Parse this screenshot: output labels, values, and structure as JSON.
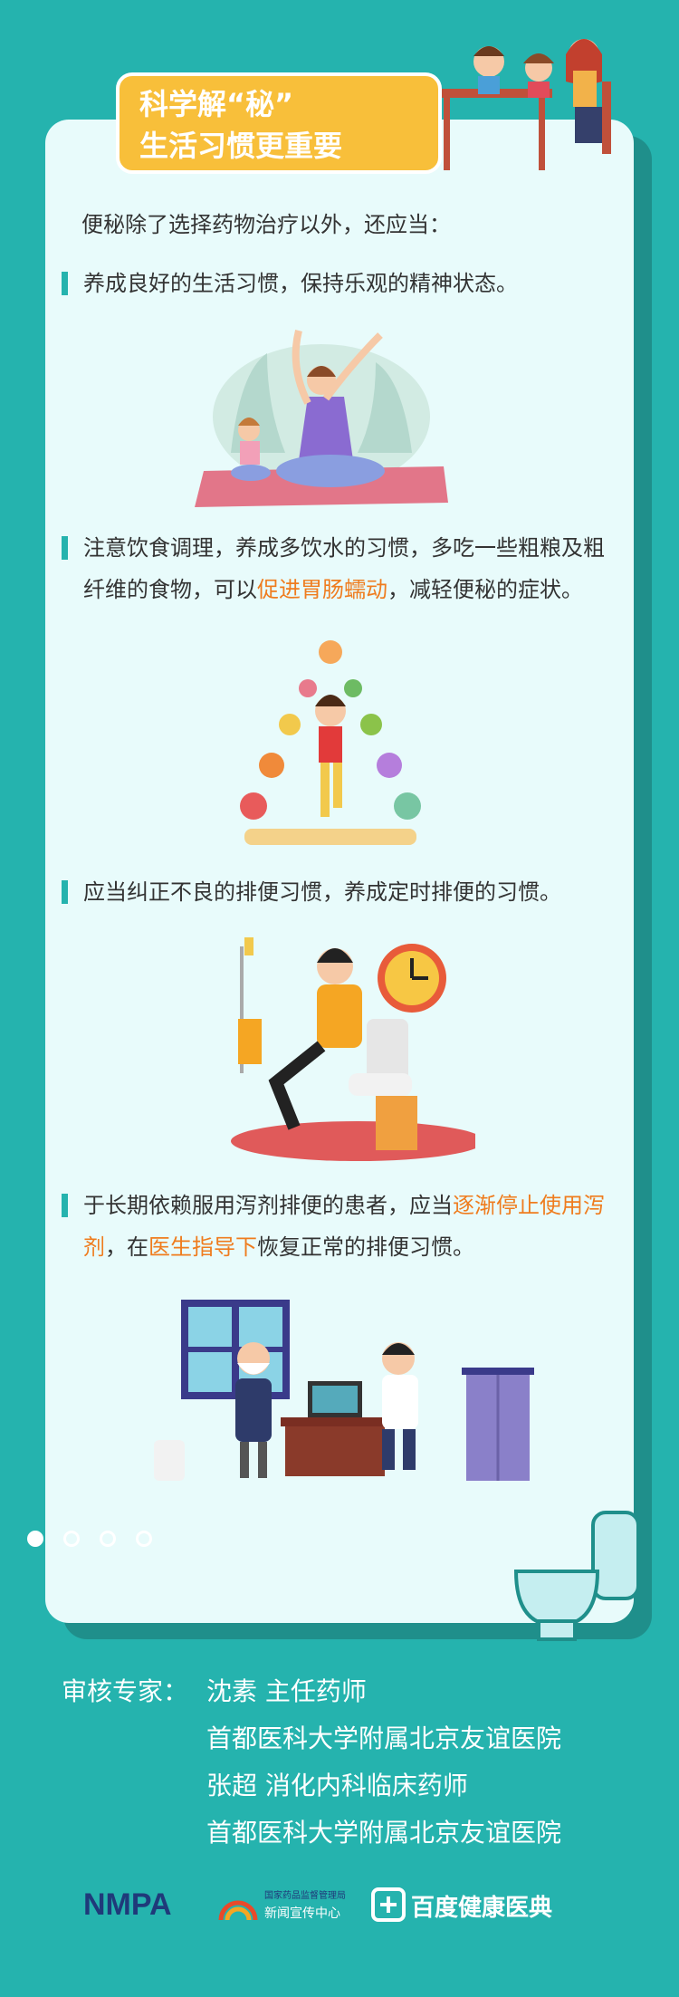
{
  "title": {
    "line1": "科学解“秘”",
    "line2": "生活习惯更重要"
  },
  "intro": "便秘除了选择药物治疗以外，还应当：",
  "points": [
    {
      "pre": "养成良好的生活习惯，保持乐观的精神状态。"
    },
    {
      "pre": "注意饮食调理，养成多饮水的习惯，多吃一些粗粮及粗纤维的食物，可以",
      "hl": "促进胃肠蠕动",
      "post": "，减轻便秘的症状。"
    },
    {
      "pre": "应当纠正不良的排便习惯，养成定时排便的习惯。"
    },
    {
      "pre": "于长期依赖服用泻剂排便的患者，应当",
      "hl": "逐渐停止使用泻剂",
      "mid": "，在",
      "hl2": "医生指导下",
      "post": "恢复正常的排便习惯。"
    }
  ],
  "footer": {
    "reviewer_label": "审核专家：",
    "expert1": "沈素  主任药师",
    "hospital1": "首都医科大学附属北京友谊医院",
    "expert2": "张超  消化内科临床药师",
    "hospital2": "首都医科大学附属北京友谊医院"
  },
  "logos": {
    "nmpa": "NMPA",
    "nmpa_sub1": "国家药品监督管理局",
    "nmpa_sub2": "新闻宣传中心",
    "baidu": "百度健康医典"
  },
  "colors": {
    "accent": "#25b3ae",
    "highlight": "#ef7c1e",
    "title_bg": "#f8bf3a"
  }
}
